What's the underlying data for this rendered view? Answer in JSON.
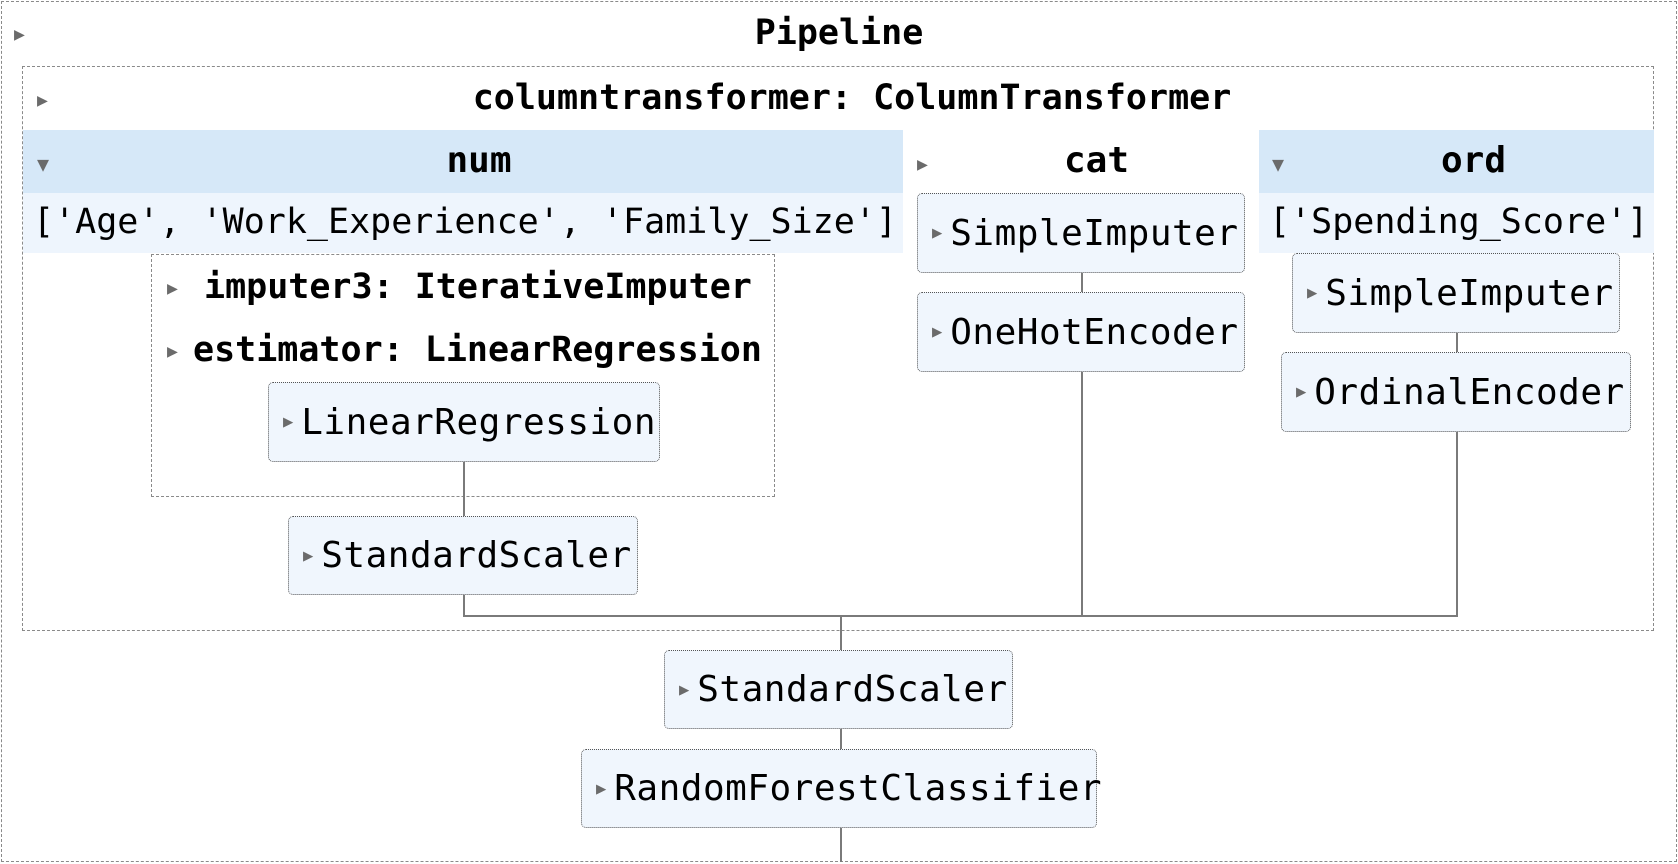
{
  "pipeline": {
    "title": "Pipeline",
    "column_transformer": {
      "title": "columntransformer: ColumnTransformer",
      "branches": {
        "num": {
          "name": "num",
          "columns": "['Age', 'Work_Experience', 'Family_Size']",
          "imputer_title": "imputer3: IterativeImputer",
          "estimator_title": "estimator: LinearRegression",
          "estimator_step": "LinearRegression",
          "scaler_step": "StandardScaler"
        },
        "cat": {
          "name": "cat",
          "step1": "SimpleImputer",
          "step2": "OneHotEncoder"
        },
        "ord": {
          "name": "ord",
          "columns": "['Spending_Score']",
          "step1": "SimpleImputer",
          "step2": "OrdinalEncoder"
        }
      }
    },
    "steps": {
      "scaler": "StandardScaler",
      "classifier": "RandomForestClassifier"
    }
  },
  "colors": {
    "header_band": "#d6e8f8",
    "columns_band": "#eef5fd",
    "step_fill": "#f0f6fd",
    "connector": "#7a7a7a"
  },
  "icons": {
    "collapsed": "triangle-right",
    "expanded": "triangle-down"
  }
}
